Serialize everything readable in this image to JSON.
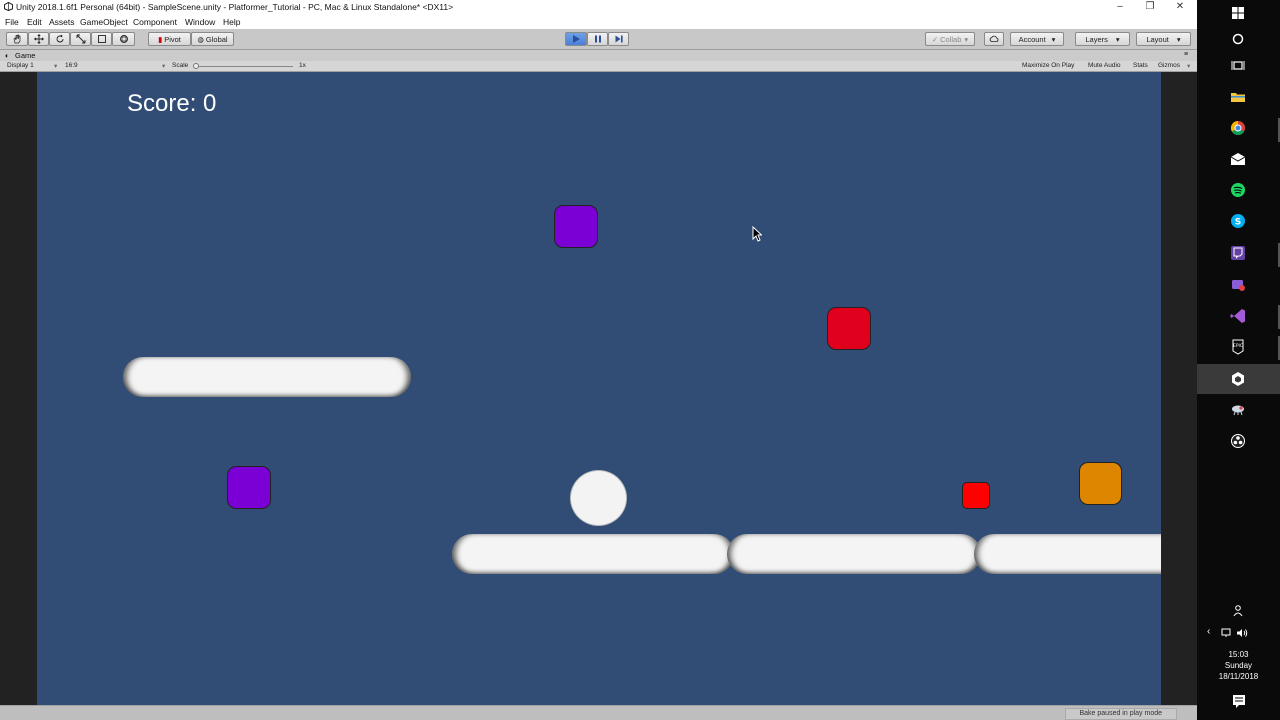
{
  "window": {
    "title": "Unity 2018.1.6f1 Personal (64bit) - SampleScene.unity - Platformer_Tutorial - PC, Mac & Linux Standalone* <DX11>",
    "controls": [
      "–",
      "❐",
      "✕"
    ]
  },
  "menu": {
    "items": [
      "File",
      "Edit",
      "Assets",
      "GameObject",
      "Component",
      "Window",
      "Help"
    ]
  },
  "toolbar": {
    "pivot": "Pivot",
    "global": "Global",
    "collab": "Collab",
    "account": "Account",
    "layers": "Layers",
    "layout": "Layout"
  },
  "game_tab": {
    "label": "Game",
    "display": "Display 1",
    "aspect": "16:9",
    "scale_label": "Scale",
    "scale_value": "1x",
    "maximize": "Maximize On Play",
    "mute": "Mute Audio",
    "stats": "Stats",
    "gizmos": "Gizmos"
  },
  "game": {
    "score_text": "Score: 0",
    "colors": {
      "background": "#324d75",
      "purple": "#7a00d6",
      "red": "#e0001e",
      "small_red": "#ff0000",
      "orange": "#df8600",
      "platform": "#f4f4f4"
    }
  },
  "status": {
    "bake": "Bake paused in play mode"
  },
  "taskbar": {
    "time": "15:03",
    "day": "Sunday",
    "date": "18/11/2018",
    "icons": [
      "windows-icon",
      "cortana-icon",
      "task-view-icon",
      "file-explorer-icon",
      "chrome-icon",
      "mail-icon",
      "spotify-icon",
      "skype-icon",
      "twitch-icon",
      "app-icon",
      "visual-studio-icon",
      "epic-games-icon",
      "unity-icon",
      "app-icon",
      "obs-icon"
    ]
  }
}
